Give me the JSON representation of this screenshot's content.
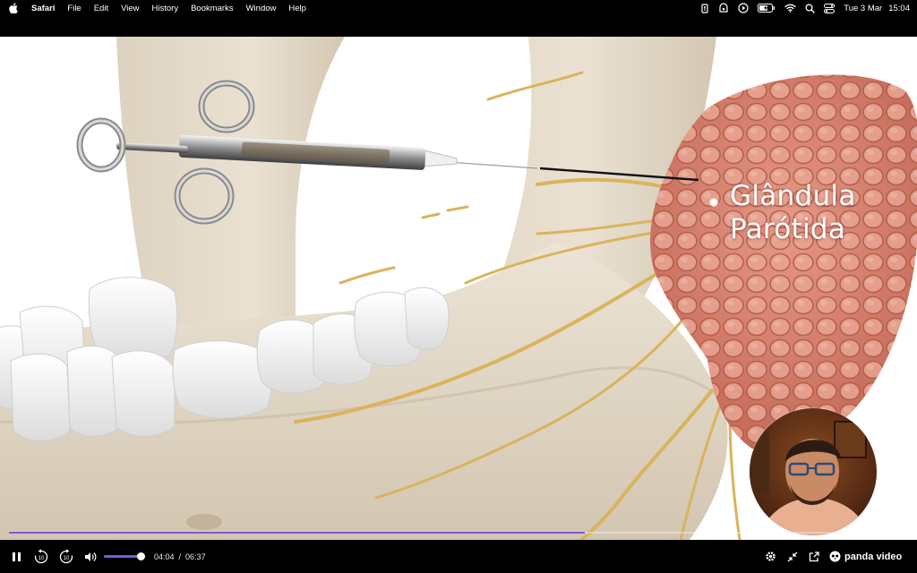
{
  "menubar": {
    "apple_icon": "apple-logo",
    "app_name": "Safari",
    "menus": [
      "File",
      "Edit",
      "View",
      "History",
      "Bookmarks",
      "Window",
      "Help"
    ],
    "status_icons": [
      "password-icon",
      "vpn-icon",
      "play-circle-icon",
      "battery-icon",
      "wifi-icon",
      "search-icon",
      "control-center-icon"
    ],
    "date": "Tue 3 Mar",
    "time": "15:04"
  },
  "video": {
    "label_line1": "Glândula",
    "label_line2": "Parótida"
  },
  "player": {
    "current_time": "04:04",
    "separator": "/",
    "duration": "06:37",
    "progress_fraction": 0.64,
    "volume_fraction": 0.9,
    "rewind_seconds": "10",
    "forward_seconds": "10",
    "brand_name": "panda video",
    "accent_color": "#7b5bd6"
  }
}
